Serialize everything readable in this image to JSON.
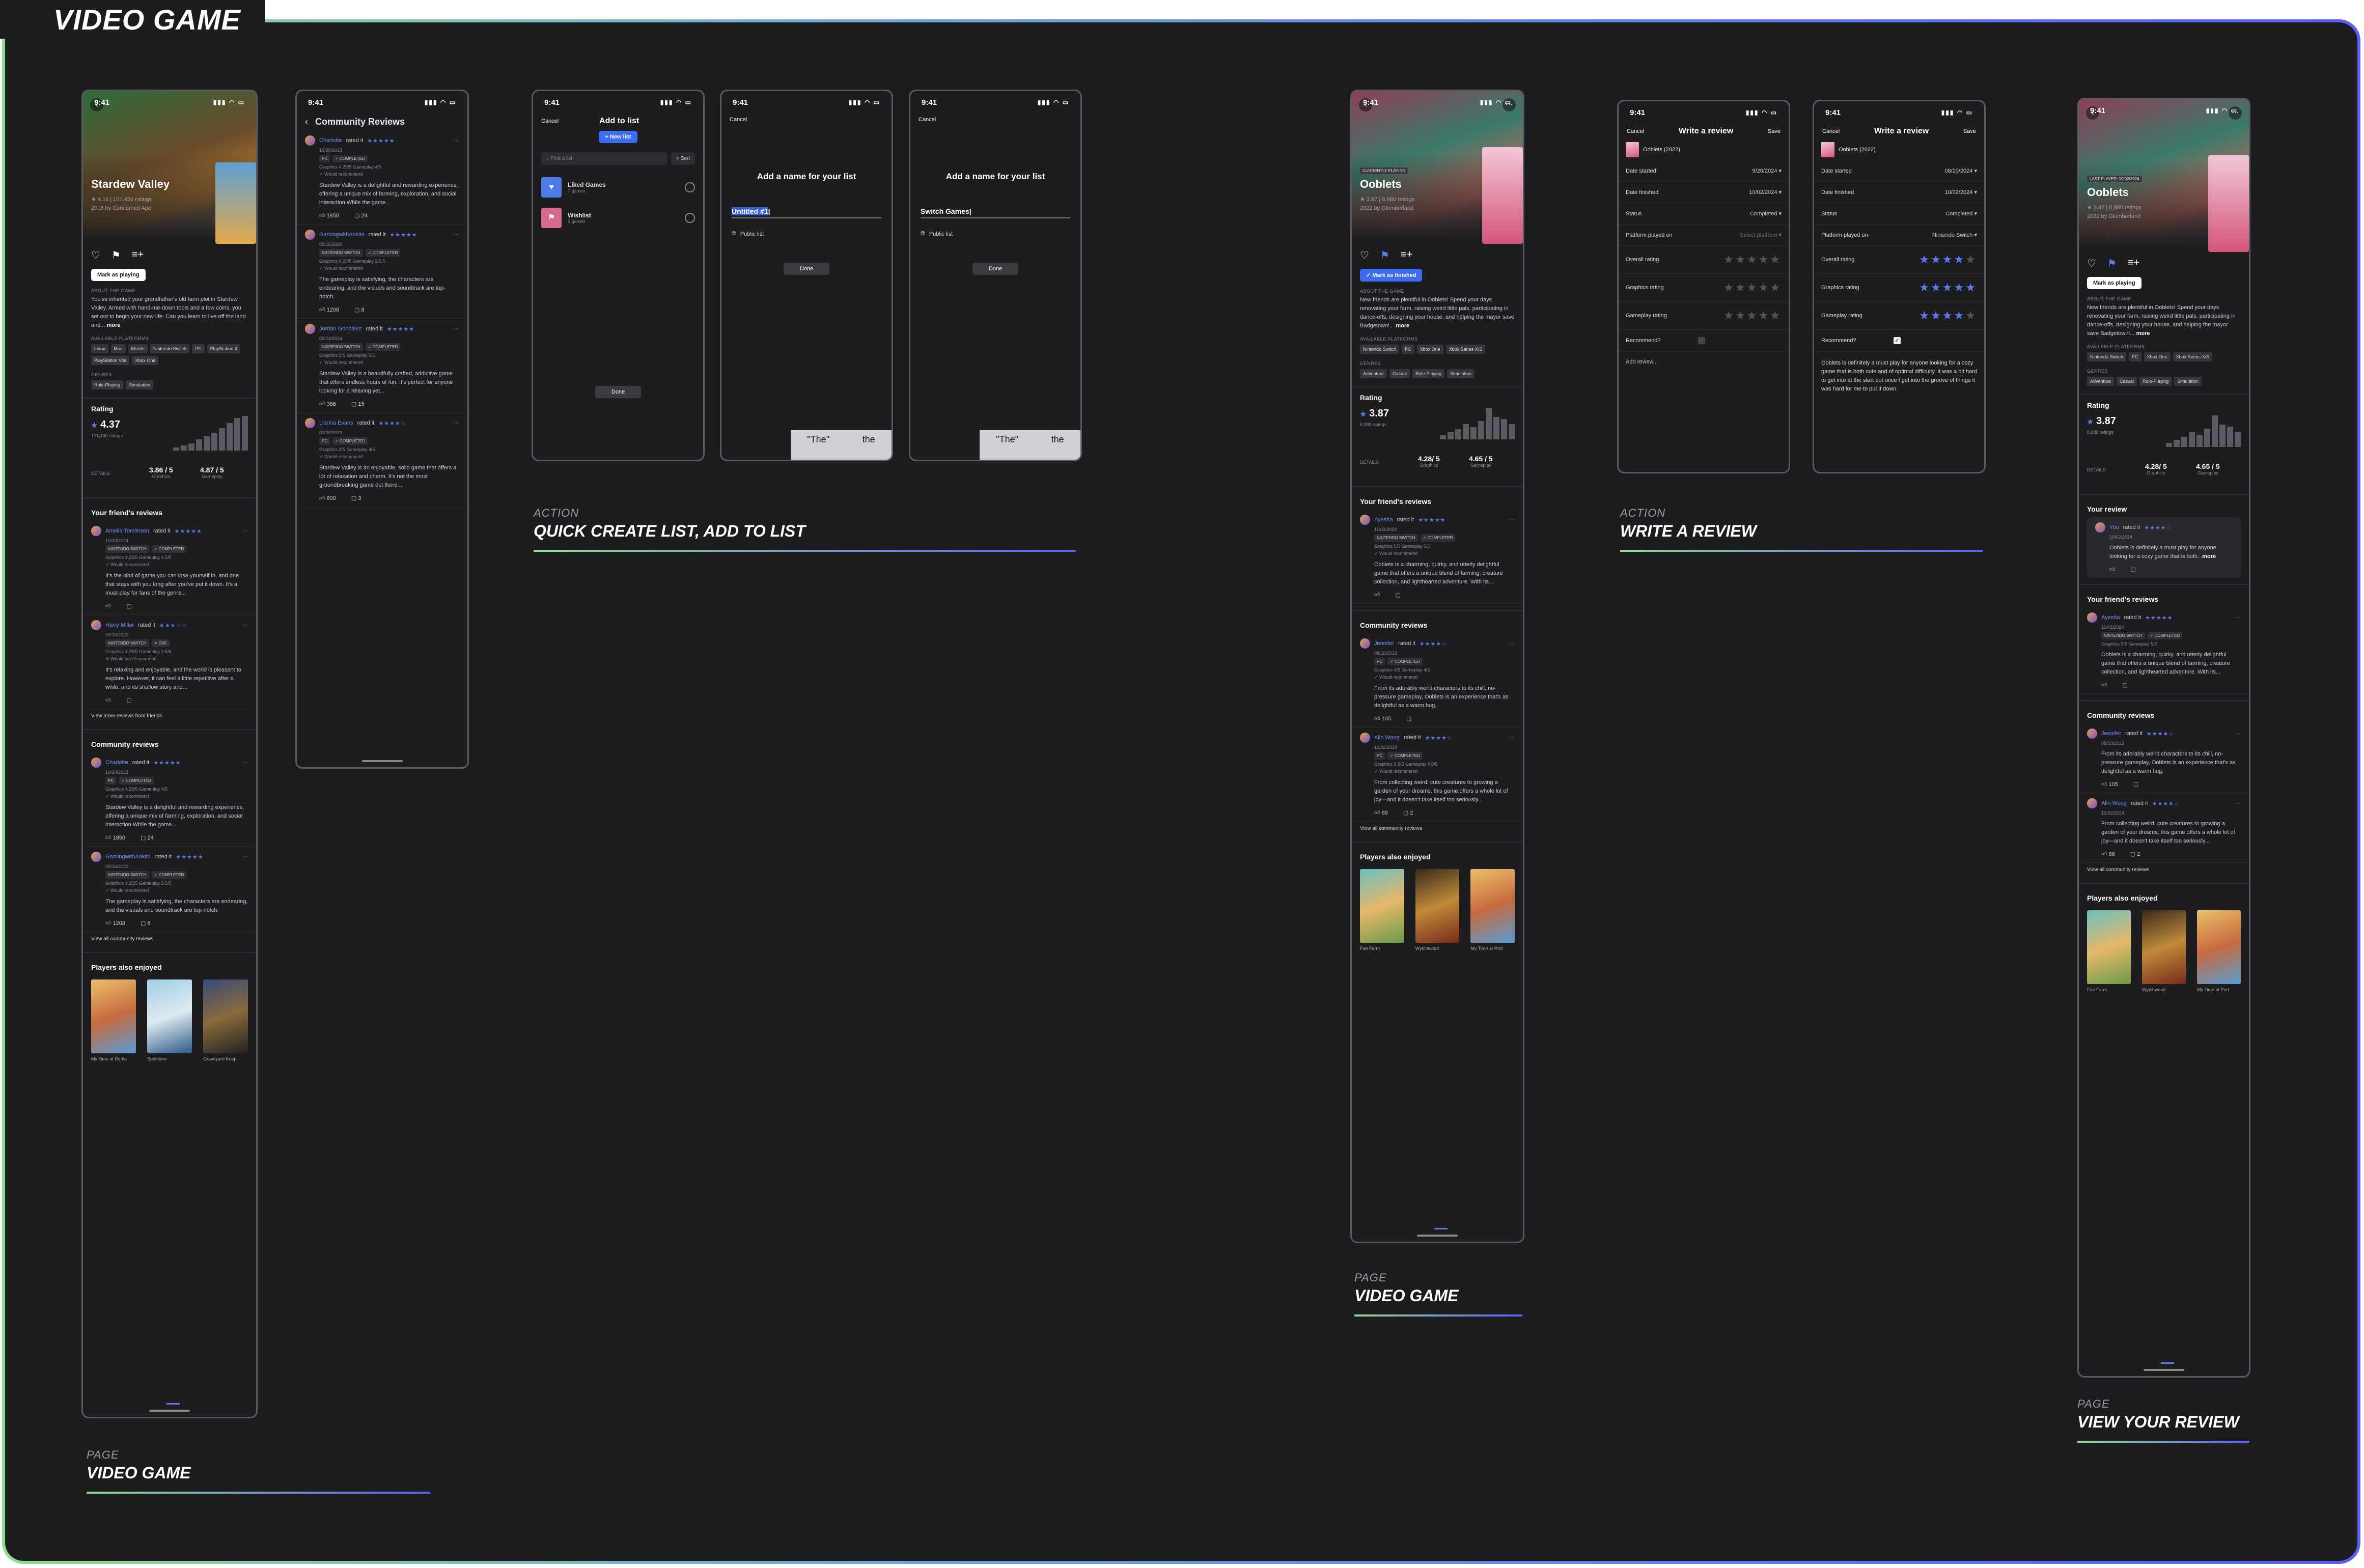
{
  "board": {
    "title": "VIDEO GAME"
  },
  "status": {
    "time": "9:41"
  },
  "captions": [
    {
      "kicker": "PAGE",
      "label": "VIDEO GAME"
    },
    {
      "kicker": "ACTION",
      "label": "QUICK CREATE LIST, ADD TO LIST"
    },
    {
      "kicker": "ACTION",
      "label": "WRITE A REVIEW"
    },
    {
      "kicker": "PAGE",
      "label": "VIDEO GAME"
    },
    {
      "kicker": "PAGE",
      "label": "VIEW YOUR REVIEW"
    }
  ],
  "stardew": {
    "title": "Stardew Valley",
    "rating_line": "★ 4.16 | 101,450 ratings",
    "studio_line": "2016 by Concerned Ape",
    "cta": "Mark as playing",
    "about_label": "ABOUT THE GAME",
    "about": "You've inherited your grandfather's old farm plot in Stardew Valley. Armed with hand-me-down tools and a few coins, you set out to begin your new life. Can you learn to live off the land and...",
    "more": "more",
    "platforms_label": "AVAILABLE PLATFORMS",
    "platforms": [
      "Linux",
      "Mac",
      "Mobile",
      "Nintendo Switch",
      "PC",
      "PlayStation 4",
      "PlayStation Vita",
      "Xbox One"
    ],
    "genres_label": "GENRES",
    "genres": [
      "Role-Playing",
      "Simulation"
    ],
    "rating_title": "Rating",
    "rating": "4.37",
    "rating_count": "101,430 ratings",
    "details": "DETAILS",
    "graphics": "3.86 / 5",
    "graphics_l": "Graphics",
    "gameplay": "4.87 / 5",
    "gameplay_l": "Gameplay",
    "friends_title": "Your friend's reviews",
    "friends": [
      {
        "name": "Amelia Tomlinson",
        "rated": "rated it",
        "stars": "★★★★★",
        "date": "10/30/2024",
        "tags": [
          "NINTENDO SWITCH",
          "✓ COMPLETED"
        ],
        "meta": "Graphics 4.25/5   Gameplay 4.5/5",
        "rec": "✓ Would recommend",
        "body": "It's the kind of game you can lose yourself in, and one that stays with you long after you've put it down. It's a must-play for fans of the genre...",
        "likes": "",
        "comments": ""
      },
      {
        "name": "Harry Miller",
        "rated": "rated it",
        "stars": "★★★☆☆",
        "date": "02/10/2020",
        "tags": [
          "NINTENDO SWITCH",
          "✕ DNF"
        ],
        "meta": "Graphics 4.25/5   Gameplay 3.5/5",
        "rec": "✕ Would not recommend",
        "body": "It's relaxing and enjoyable, and the world is pleasant to explore. However, it can feel a little repetitive after a while, and its shallow story and...",
        "likes": "",
        "comments": ""
      }
    ],
    "more_friends": "View more reviews from friends",
    "community_title": "Community reviews",
    "community": [
      {
        "name": "Charlotte",
        "rated": "rated it",
        "stars": "★★★★★",
        "date": "10/20/2023",
        "tags": [
          "PC",
          "✓ COMPLETED"
        ],
        "meta": "Graphics 4.25/5   Gameplay 4/5",
        "rec": "✓ Would recommend",
        "body": "Stardew Valley is a delightful and rewarding experience, offering a unique mix of farming, exploration, and social interaction.While the game...",
        "likes": "1850",
        "comments": "24"
      },
      {
        "name": "GamingwithAnkita",
        "rated": "rated it",
        "stars": "★★★★★",
        "date": "02/16/2020",
        "tags": [
          "NINTENDO SWITCH",
          "✓ COMPLETED"
        ],
        "meta": "Graphics 4.25/5   Gameplay 3.5/5",
        "rec": "✓ Would recommend",
        "body": "The gameplay is satisfying, the characters are endearing, and the visuals and soundtrack are top-notch.",
        "likes": "1208",
        "comments": "8"
      }
    ],
    "all_community": "View all community reviews",
    "also_title": "Players also enjoyed",
    "also": [
      "My Time at Portia",
      "Spiritfarer",
      "Graveyard Keep"
    ]
  },
  "community_page": {
    "title": "Community Reviews",
    "reviews": [
      {
        "name": "Charlotte",
        "rated": "rated it",
        "stars": "★★★★★",
        "date": "10/20/2023",
        "tags": [
          "PC",
          "✓ COMPLETED"
        ],
        "meta": "Graphics 4.25/5   Gameplay 4/5",
        "rec": "✓ Would recommend",
        "body": "Stardew Valley is a delightful and rewarding experience, offering a unique mix of farming, exploration, and social interaction.While the game...",
        "likes": "1850",
        "comments": "24"
      },
      {
        "name": "GamingwithAnkita",
        "rated": "rated it",
        "stars": "★★★★★",
        "date": "02/16/2020",
        "tags": [
          "NINTENDO SWITCH",
          "✓ COMPLETED"
        ],
        "meta": "Graphics 4.25/5   Gameplay 3.5/5",
        "rec": "✓ Would recommend",
        "body": "The gameplay is satisfying, the characters are endearing, and the visuals and soundtrack are top-notch.",
        "likes": "1208",
        "comments": "8"
      },
      {
        "name": "Jordan Gonzalez",
        "rated": "rated it",
        "stars": "★★★★★",
        "date": "02/14/2024",
        "tags": [
          "NINTENDO SWITCH",
          "✓ COMPLETED"
        ],
        "meta": "Graphics 5/5   Gameplay 5/5",
        "rec": "✓ Would recommend",
        "body": "Stardew Valley is a beautifully crafted, addictive game that offers endless hours of fun. It's perfect for anyone looking for a relaxing yet...",
        "likes": "386",
        "comments": "15"
      },
      {
        "name": "Lianna Evans",
        "rated": "rated it",
        "stars": "★★★★☆",
        "date": "02/20/2023",
        "tags": [
          "PC",
          "✓ COMPLETED"
        ],
        "meta": "Graphics 4/5   Gameplay 4/5",
        "rec": "✓ Would recommend",
        "body": "Stardew Valley is an enjoyable, solid game that offers a lot of relaxation and charm. It's not the most groundbreaking game out there...",
        "likes": "600",
        "comments": "3"
      }
    ]
  },
  "add_list": {
    "cancel": "Cancel",
    "title": "Add to list",
    "new_list": "+ New list",
    "search_ph": "Find a list",
    "sort": "Sort",
    "lists": [
      {
        "name": "Liked Games",
        "count": "7 games"
      },
      {
        "name": "Wishlist",
        "count": "5 games"
      }
    ],
    "done": "Done"
  },
  "name_list_1": {
    "cancel": "Cancel",
    "title": "Add a name for your list",
    "value": "Untitled #1",
    "public": "Public list",
    "done": "Done",
    "suggest": "\"The\"",
    "suggest2": "the"
  },
  "name_list_2": {
    "cancel": "Cancel",
    "title": "Add a name for your list",
    "value": "Switch Games",
    "public": "Public list",
    "done": "Done",
    "suggest": "\"The\"",
    "suggest2": "the"
  },
  "ooblets": {
    "title": "Ooblets",
    "rating_line": "★ 3.87 | 8,980 ratings",
    "studio_line": "2022 by Glumberland",
    "badge": "CURRENTLY PLAYING",
    "cta": "✓ Mark as finished",
    "about_label": "ABOUT THE GAME",
    "about": "New friends are plentiful in Ooblets! Spend your days renovating your farm, raising weird little pals, participating in dance-offs, designing your house, and helping the mayor save Badgetown!...",
    "more": "more",
    "platforms_label": "AVAILABLE PLATFORMS",
    "platforms": [
      "Nintendo Switch",
      "PC",
      "Xbox One",
      "Xbox Series X/S"
    ],
    "genres_label": "GENRES",
    "genres": [
      "Adventure",
      "Casual",
      "Role-Playing",
      "Simulation"
    ],
    "rating_title": "Rating",
    "rating": "3.87",
    "rating_count": "8,980 ratings",
    "details": "DETAILS",
    "graphics": "4.28/ 5",
    "graphics_l": "Graphics",
    "gameplay": "4.65 / 5",
    "gameplay_l": "Gameplay",
    "friends_title": "Your friend's reviews",
    "friend": {
      "name": "Ayesha",
      "rated": "rated it",
      "stars": "★★★★★",
      "date": "11/02/2024",
      "tags": [
        "NINTENDO SWITCH",
        "✓ COMPLETED"
      ],
      "meta": "Graphics 5/5   Gameplay 5/5",
      "rec": "✓ Would recommend",
      "body": "Ooblets is a charming, quirky, and utterly delightful game that offers a unique blend of farming, creature collection, and lighthearted adventure. With its...",
      "likes": "",
      "comments": ""
    },
    "community_title": "Community reviews",
    "community": [
      {
        "name": "Jennifer",
        "rated": "rated it",
        "stars": "★★★★☆",
        "date": "08/10/2023",
        "tags": [
          "PC",
          "✓ COMPLETED"
        ],
        "meta": "Graphics 4/5   Gameplay 4/5",
        "rec": "✓ Would recommend",
        "body": "From its adorably weird characters to its chill, no-pressure gameplay, Ooblets is an experience that's as delightful as a warm hug.",
        "likes": "105",
        "comments": ""
      },
      {
        "name": "Alin Wong",
        "rated": "rated it",
        "stars": "★★★★☆",
        "date": "10/02/2024",
        "tags": [
          "PC",
          "✓ COMPLETED"
        ],
        "meta": "Graphics 3.5/5   Gameplay 4.5/5",
        "rec": "✓ Would recommend",
        "body": "From collecting weird, cute creatures to growing a garden of your dreams, this game offers a whole lot of joy—and it doesn't take itself too seriously...",
        "likes": "88",
        "comments": "2"
      }
    ],
    "all_community": "View all community reviews",
    "also_title": "Players also enjoyed",
    "also": [
      "Fae Farm",
      "Wytchwood",
      "My Time at Port"
    ]
  },
  "review_empty": {
    "cancel": "Cancel",
    "title": "Write a review",
    "save": "Save",
    "game": "Ooblets (2022)",
    "rows": [
      {
        "label": "Date started",
        "value": "9/20/2024 ▾"
      },
      {
        "label": "Date finished",
        "value": "10/02/2024 ▾"
      },
      {
        "label": "Status",
        "value": "Completed ▾"
      },
      {
        "label": "Platform played on",
        "value": "Select platform ▾"
      }
    ],
    "ratings": [
      {
        "label": "Overall rating",
        "value": 0
      },
      {
        "label": "Graphics rating",
        "value": 0
      },
      {
        "label": "Gameplay rating",
        "value": 0
      }
    ],
    "recommend": "Recommend?",
    "add_review": "Add review..."
  },
  "review_filled": {
    "cancel": "Cancel",
    "title": "Write a review",
    "save": "Save",
    "game": "Ooblets (2022)",
    "rows": [
      {
        "label": "Date started",
        "value": "08/20/2024 ▾"
      },
      {
        "label": "Date finished",
        "value": "10/02/2024 ▾"
      },
      {
        "label": "Status",
        "value": "Completed ▾"
      },
      {
        "label": "Platform played on",
        "value": "Nintendo Switch ▾"
      }
    ],
    "ratings": [
      {
        "label": "Overall rating",
        "value": 3.5
      },
      {
        "label": "Graphics rating",
        "value": 5
      },
      {
        "label": "Gameplay rating",
        "value": 4
      }
    ],
    "recommend": "Recommend?",
    "text": "Ooblets is definitely a must play for anyone looking for a cozy game that is both cute and of optimal difficulty. It was a bit hard to get into at the start but once I got into the groove of things it was hard for me to put it down."
  },
  "your_review": {
    "title": "Your review",
    "name": "You",
    "rated": "rated it",
    "stars": "★★★★☆",
    "date": "10/02/2024",
    "body": "Ooblets is definitely a must play for anyone looking for a cozy game that is both...",
    "badge": "LAST PLAYED: 10/02/2024"
  }
}
